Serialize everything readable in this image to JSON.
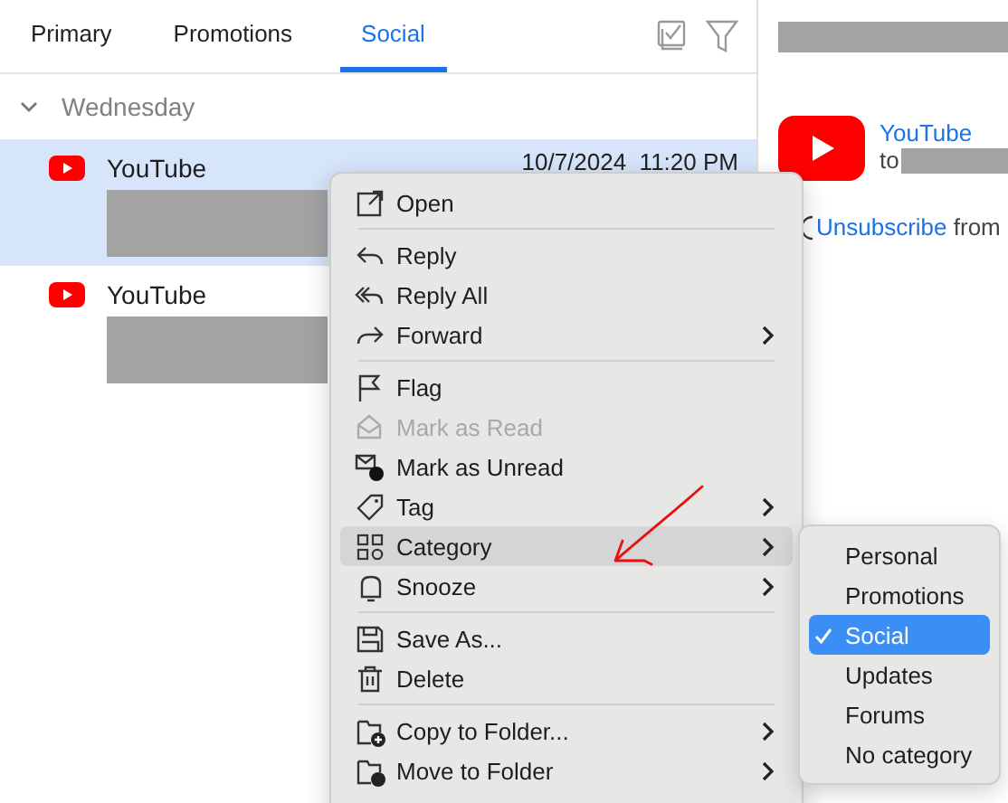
{
  "tabs": [
    {
      "label": "Primary",
      "selected": false
    },
    {
      "label": "Promotions",
      "selected": false
    },
    {
      "label": "Social",
      "selected": true
    }
  ],
  "group": {
    "label": "Wednesday",
    "expanded": true
  },
  "messages": [
    {
      "sender": "YouTube",
      "date": "10/7/2024  11:20 PM",
      "selected": true
    },
    {
      "sender": "YouTube",
      "selected": false
    }
  ],
  "reading_pane": {
    "sender": "YouTube",
    "recipient_prefix": "to",
    "unsubscribe_link": "Unsubscribe",
    "unsubscribe_suffix": "from"
  },
  "context_menu": {
    "items": [
      {
        "kind": "item",
        "label": "Open",
        "disabled": false,
        "highlighted": false,
        "submenu": false
      },
      {
        "kind": "separator"
      },
      {
        "kind": "item",
        "label": "Reply",
        "disabled": false,
        "highlighted": false,
        "submenu": false
      },
      {
        "kind": "item",
        "label": "Reply All",
        "disabled": false,
        "highlighted": false,
        "submenu": false
      },
      {
        "kind": "item",
        "label": "Forward",
        "disabled": false,
        "highlighted": false,
        "submenu": true
      },
      {
        "kind": "separator"
      },
      {
        "kind": "item",
        "label": "Flag",
        "disabled": false,
        "highlighted": false,
        "submenu": false
      },
      {
        "kind": "item",
        "label": "Mark as Read",
        "disabled": true,
        "highlighted": false,
        "submenu": false
      },
      {
        "kind": "item",
        "label": "Mark as Unread",
        "disabled": false,
        "highlighted": false,
        "submenu": false
      },
      {
        "kind": "item",
        "label": "Tag",
        "disabled": false,
        "highlighted": false,
        "submenu": true
      },
      {
        "kind": "item",
        "label": "Category",
        "disabled": false,
        "highlighted": true,
        "submenu": true
      },
      {
        "kind": "item",
        "label": "Snooze",
        "disabled": false,
        "highlighted": false,
        "submenu": true
      },
      {
        "kind": "separator"
      },
      {
        "kind": "item",
        "label": "Save As...",
        "disabled": false,
        "highlighted": false,
        "submenu": false
      },
      {
        "kind": "item",
        "label": "Delete",
        "disabled": false,
        "highlighted": false,
        "submenu": false
      },
      {
        "kind": "separator"
      },
      {
        "kind": "item",
        "label": "Copy to Folder...",
        "disabled": false,
        "highlighted": false,
        "submenu": true
      },
      {
        "kind": "item",
        "label": "Move to Folder",
        "disabled": false,
        "highlighted": false,
        "submenu": true
      }
    ]
  },
  "category_submenu": {
    "items": [
      {
        "label": "Personal",
        "selected": false
      },
      {
        "label": "Promotions",
        "selected": false
      },
      {
        "label": "Social",
        "selected": true
      },
      {
        "label": "Updates",
        "selected": false
      },
      {
        "label": "Forums",
        "selected": false
      },
      {
        "label": "No category",
        "selected": false
      }
    ]
  }
}
